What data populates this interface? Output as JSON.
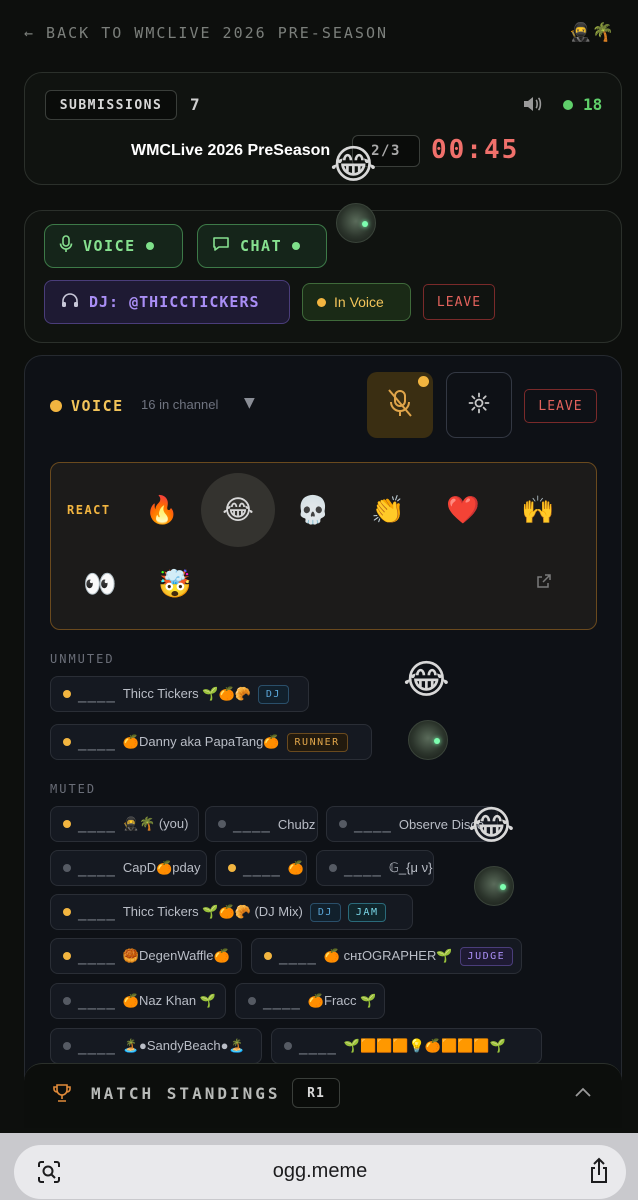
{
  "nav": {
    "back_label": "← BACK TO WMCLIVE 2026 PRE-SEASON",
    "top_emoji": "🥷🌴"
  },
  "match": {
    "submissions_label": "SUBMISSIONS",
    "submissions_count": "7",
    "online_count": "18",
    "event_title": "WMCLive 2026 PreSeason",
    "round": "2/3",
    "timer": "00:45"
  },
  "controls": {
    "voice_label": "VOICE",
    "chat_label": "CHAT",
    "dj_label": "DJ: @THICCTICKERS",
    "in_voice_label": "In Voice",
    "leave_label": "LEAVE"
  },
  "voice_panel": {
    "title": "VOICE",
    "count_text": "16 in channel",
    "leave_label": "LEAVE",
    "react_label": "REACT",
    "reactions": [
      "🔥",
      "😂",
      "💀",
      "👏",
      "❤️",
      "🙌",
      "👀",
      "🤯"
    ],
    "unmuted_label": "UNMUTED",
    "muted_label": "MUTED",
    "unmuted": [
      {
        "name": "Thicc Tickers 🌱🍊🥐",
        "tag": "DJ"
      },
      {
        "name": "🍊Danny aka PapaTang🍊",
        "tag": "RUNNER"
      }
    ],
    "muted": [
      {
        "name": "🥷🌴 (you)"
      },
      {
        "name": "Chubz"
      },
      {
        "name": "Observe Disco"
      },
      {
        "name": "CapD🍊pday"
      },
      {
        "name": "🍊"
      },
      {
        "name": "𝔾_{μ ν}"
      },
      {
        "name": "Thicc Tickers 🌱🍊🥐 (DJ Mix)",
        "tag1": "DJ",
        "tag2": "JAM"
      },
      {
        "name": "🥮DegenWaffle🍊"
      },
      {
        "name": "🍊 ᴄʜɪOGRAPHER🌱",
        "tag": "JUDGE"
      },
      {
        "name": "🍊Naz Khan 🌱"
      },
      {
        "name": "🍊Fracc 🌱"
      },
      {
        "name": "🏝️●SandyBeach●🏝️"
      },
      {
        "name": "🌱🟧🟧🟧💡🍊🟧🟧🟧🌱"
      }
    ]
  },
  "floating": {
    "laugh": "😂"
  },
  "standings": {
    "title": "MATCH STANDINGS",
    "round": "R1"
  },
  "browser": {
    "url": "ogg.meme"
  },
  "colors": {
    "accent_green": "#5fcf6a",
    "accent_amber": "#f2b540",
    "timer_red": "#f0706b",
    "dj_purple": "#a98ef5"
  }
}
